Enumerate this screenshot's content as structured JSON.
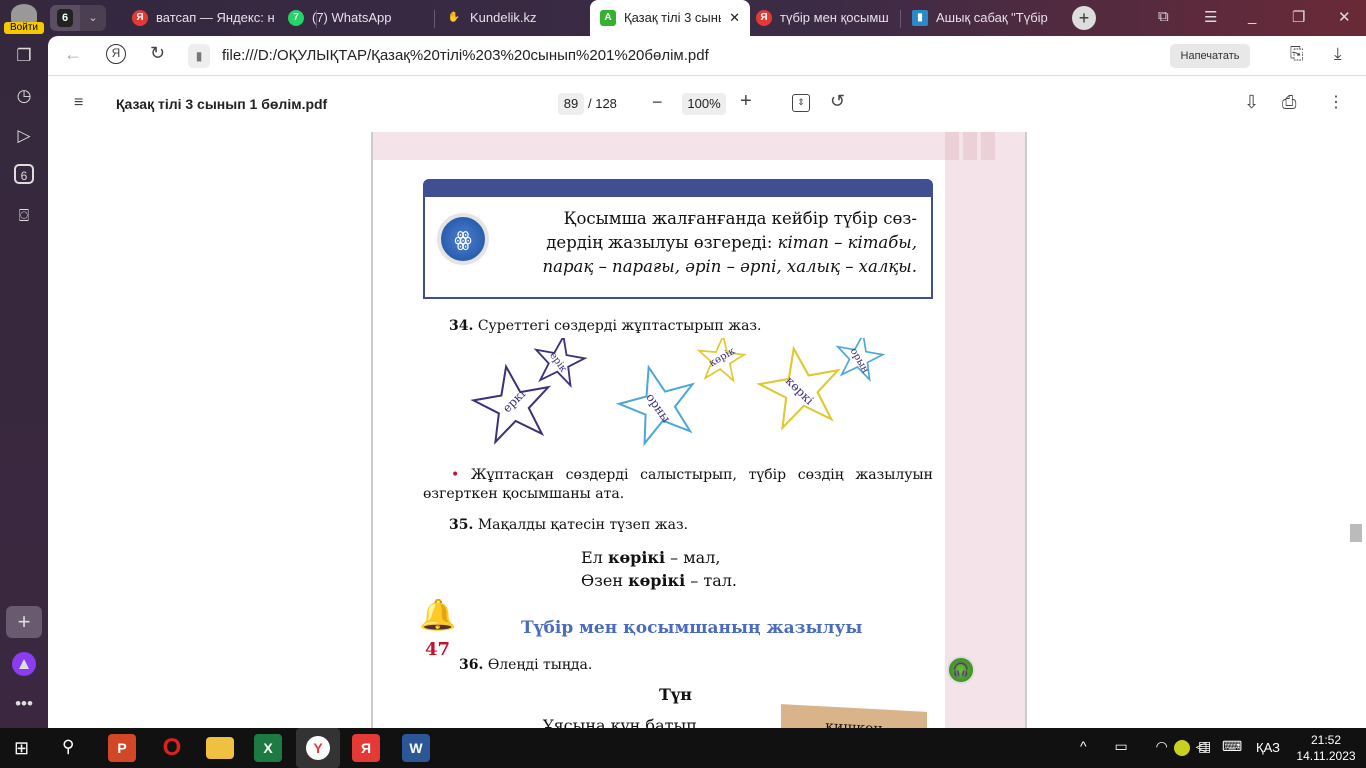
{
  "sidebar": {
    "login_label": "Войти",
    "tab_count": "6",
    "items": [
      "tabs-icon",
      "history-icon",
      "play-icon",
      "6",
      "camera-icon",
      "add-icon",
      "alice-icon",
      "more-icon"
    ],
    "badge_6": "6"
  },
  "tabs": [
    {
      "label": "ватсап — Яндекс: н",
      "icon": "Я",
      "color": "#e53935"
    },
    {
      "label": "(7) WhatsApp",
      "icon": "7",
      "color": "#25d366"
    },
    {
      "label": "Kundelik.kz",
      "icon": "✋",
      "color": "#5b6bd0"
    },
    {
      "label": "Қазақ тілі 3 сыны",
      "icon": "A",
      "color": "#35b030",
      "active": true
    },
    {
      "label": "түбір мен қосымш",
      "icon": "Я",
      "color": "#e53935"
    },
    {
      "label": "Ашық сабақ \"Түбір",
      "icon": "▮",
      "color": "#2a8ac8"
    }
  ],
  "address": {
    "url": "file:///D:/ОҚУЛЫҚТАР/Қазақ%20тілі%203%20сынып%201%20бөлім.pdf",
    "print_label": "Напечатать"
  },
  "pdf": {
    "title": "Қазақ тілі 3 сынып 1 бөлім.pdf",
    "page": "89",
    "total": "/ 128",
    "zoom": "100%"
  },
  "content": {
    "rule_line1": "Қосымша жалғанғанда кейбір түбір сөз-",
    "rule_line2_a": "дердің жазылуы өзгереді: ",
    "rule_line2_b": "кітап – кітабы,",
    "rule_line3": "парақ – парағы, әріп – әрпі, халық – халқы.",
    "ex34_num": "34.",
    "ex34_text": "Суреттегі сөздерді жұптастырып жаз.",
    "stars": [
      "еркі",
      "ерік",
      "орны",
      "көрік",
      "көркі",
      "орын"
    ],
    "bullet_text": "Жұптасқан сөздерді салыстырып, түбір сөздің жазылуын өзгерткен қосымшаны ата.",
    "ex35_num": "35.",
    "ex35_text": "Мақалды қатесін түзеп жаз.",
    "proverb1_a": "Ел ",
    "proverb1_b": "көрікі",
    "proverb1_c": " – мал,",
    "proverb2_a": "Өзен ",
    "proverb2_b": "көрікі",
    "proverb2_c": " – тал.",
    "lesson_num": "47",
    "lesson_title": "Түбір мен қосымшаның жазылуы",
    "ex36_num": "36.",
    "ex36_text": "Өлеңді тыңда.",
    "poem_title": "Түн",
    "poem_line1": "Ұясына күн батып",
    "scroll_label": "кишкен"
  },
  "taskbar": {
    "lang": "ҚАЗ",
    "time": "21:52",
    "date": "14.11.2023"
  },
  "colors": {
    "accent_blue": "#3f4f92",
    "title_blue": "#4a6cc0",
    "lesson_red": "#c8102e",
    "pink": "#f4e3e8"
  }
}
